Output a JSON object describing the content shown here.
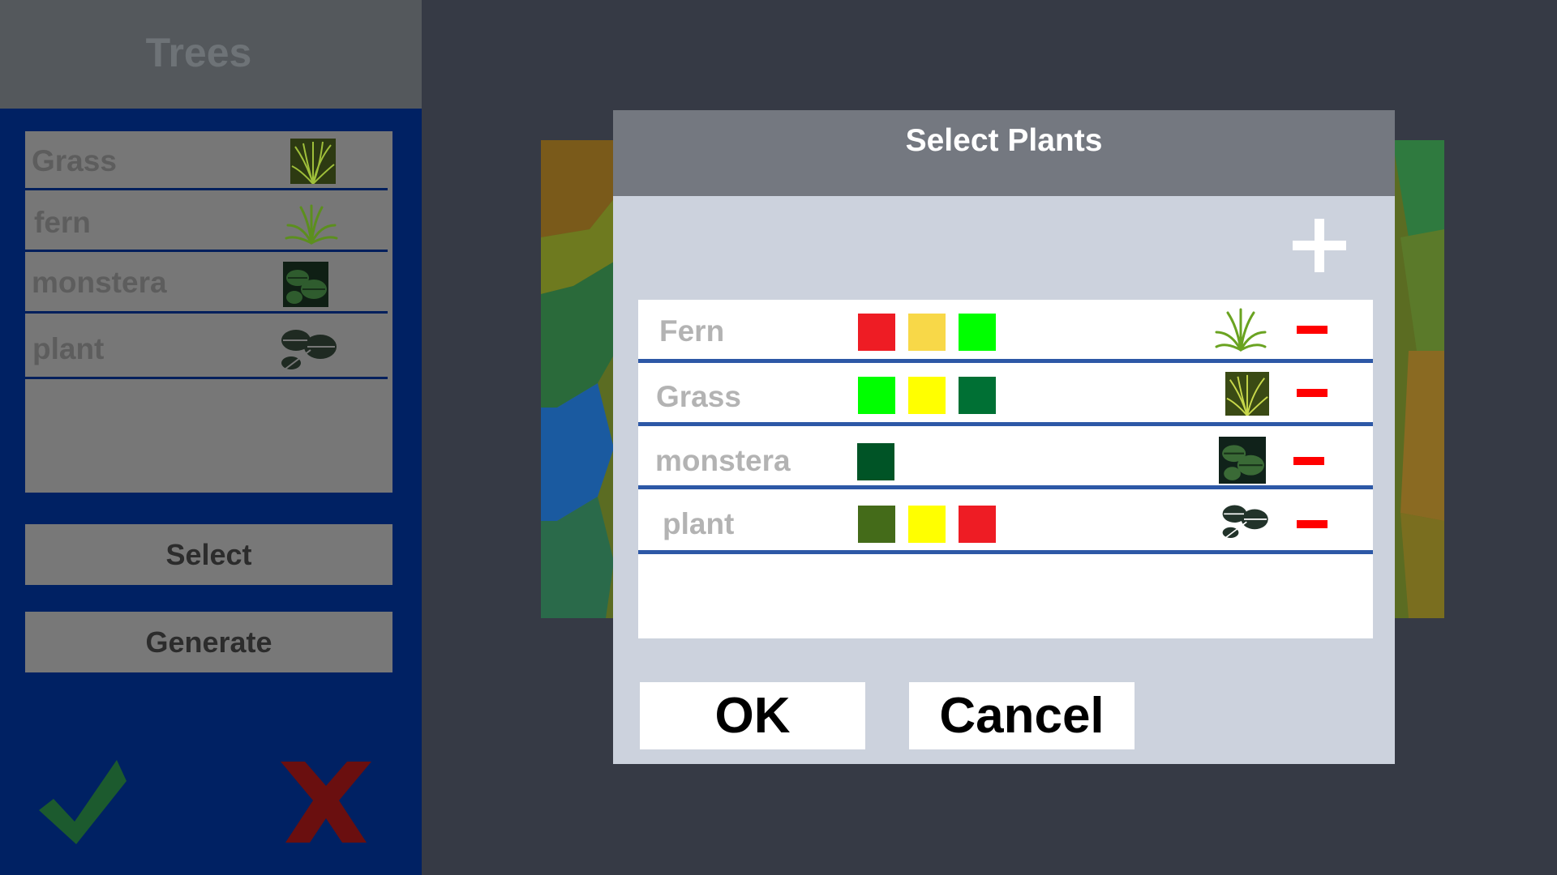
{
  "left_panel": {
    "title": "Trees",
    "items": [
      {
        "label": "Grass",
        "icon": "grass-thumbnail"
      },
      {
        "label": "fern",
        "icon": "fern-thumbnail"
      },
      {
        "label": "monstera",
        "icon": "monstera-thumbnail"
      },
      {
        "label": "plant",
        "icon": "plant-thumbnail"
      }
    ],
    "select_label": "Select",
    "generate_label": "Generate",
    "confirm_icon": "checkmark-icon",
    "reject_icon": "x-icon"
  },
  "dialog": {
    "title": "Select Plants",
    "add_icon": "plus-icon",
    "rows": [
      {
        "name": "Fern",
        "colors": [
          "#ee1c24",
          "#f8d848",
          "#00ff00"
        ],
        "icon": "fern-thumbnail"
      },
      {
        "name": "Grass",
        "colors": [
          "#00ff00",
          "#ffff00",
          "#007034"
        ],
        "icon": "grass-thumbnail"
      },
      {
        "name": "monstera",
        "colors": [
          "#005426"
        ],
        "icon": "monstera-thumbnail"
      },
      {
        "name": "plant",
        "colors": [
          "#446b19",
          "#ffff00",
          "#ee1c24"
        ],
        "icon": "plant-thumbnail"
      }
    ],
    "remove_icon": "minus-icon",
    "ok_label": "OK",
    "cancel_label": "Cancel"
  },
  "colors": {
    "background": "#363a45",
    "panel_blue": "#002163",
    "dialog_header": "#747880",
    "dialog_body": "#ccd2dd",
    "row_divider": "#2d58a6",
    "remove_red": "#ff0000"
  }
}
